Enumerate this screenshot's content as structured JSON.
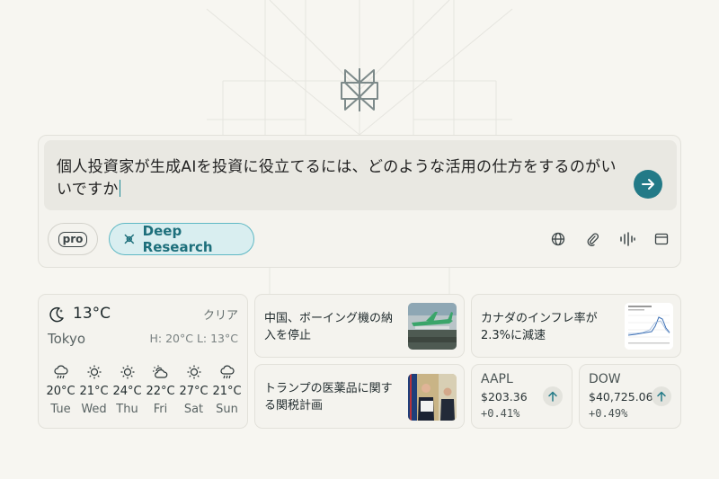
{
  "query": {
    "text": "個人投資家が生成AIを投資に役立てるには、どのような活用の仕方をするのがいいですか"
  },
  "toolbar": {
    "pro_label": "pro",
    "deep_research_label": "Deep Research",
    "icons": [
      "globe-icon",
      "paperclip-icon",
      "voice-waveform-icon",
      "window-icon"
    ]
  },
  "weather": {
    "temp": "13°C",
    "condition": "クリア",
    "city": "Tokyo",
    "high_low": "H: 20°C L: 13°C",
    "forecast": [
      {
        "day": "Tue",
        "temp": "20°C",
        "icon": "rain-cloud-icon"
      },
      {
        "day": "Wed",
        "temp": "21°C",
        "icon": "sun-icon"
      },
      {
        "day": "Thu",
        "temp": "24°C",
        "icon": "sun-icon"
      },
      {
        "day": "Fri",
        "temp": "22°C",
        "icon": "partly-cloudy-icon"
      },
      {
        "day": "Sat",
        "temp": "27°C",
        "icon": "sun-icon"
      },
      {
        "day": "Sun",
        "temp": "21°C",
        "icon": "rain-cloud-icon"
      }
    ]
  },
  "news": [
    {
      "title": "中国、ボーイング機の納入を停止"
    },
    {
      "title": "カナダのインフレ率が2.3%に減速"
    },
    {
      "title": "トランプの医薬品に関する関税計画"
    }
  ],
  "tickers": [
    {
      "symbol": "AAPL",
      "price": "$203.36",
      "change": "+0.41%"
    },
    {
      "symbol": "DOW",
      "price": "$40,725.06",
      "change": "+0.49%"
    }
  ],
  "colors": {
    "accent": "#237a87",
    "background": "#f7f6f1",
    "deep_research_bg": "#d9eef0"
  }
}
